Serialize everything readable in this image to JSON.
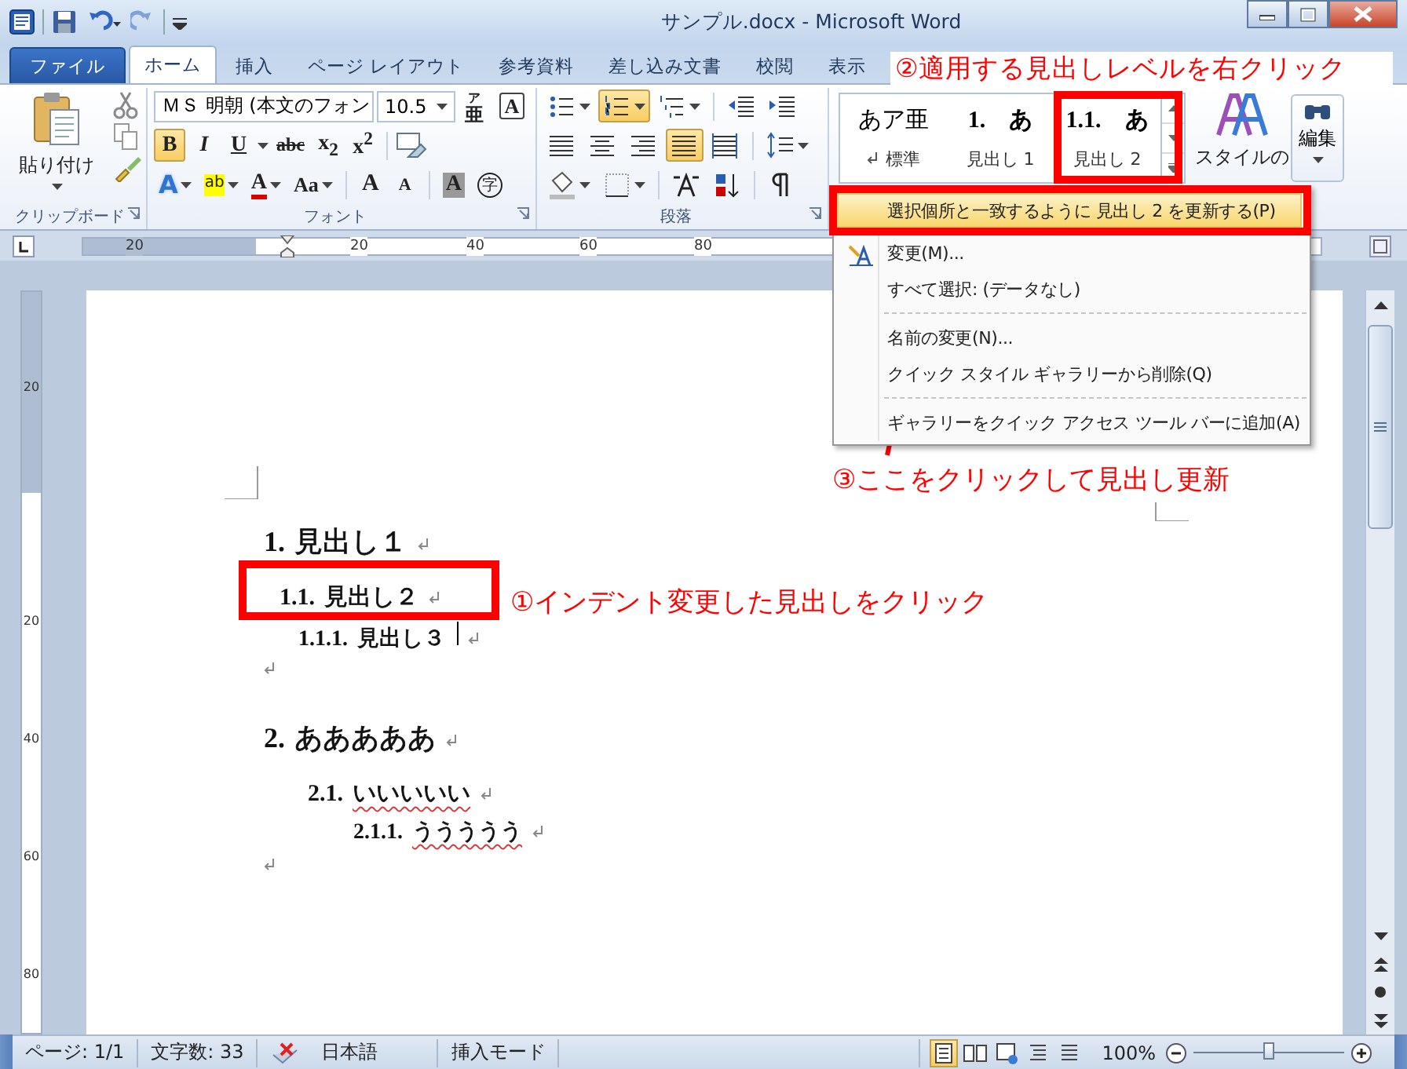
{
  "window": {
    "title": "サンプル.docx - Microsoft Word"
  },
  "tabs": [
    {
      "label": "ファイル",
      "kind": "file",
      "selected": false
    },
    {
      "label": "ホーム",
      "kind": "tab",
      "selected": true
    },
    {
      "label": "挿入",
      "kind": "tab",
      "selected": false
    },
    {
      "label": "ページ レイアウト",
      "kind": "tab",
      "selected": false
    },
    {
      "label": "参考資料",
      "kind": "tab",
      "selected": false
    },
    {
      "label": "差し込み文書",
      "kind": "tab",
      "selected": false
    },
    {
      "label": "校閲",
      "kind": "tab",
      "selected": false
    },
    {
      "label": "表示",
      "kind": "tab",
      "selected": false
    }
  ],
  "ribbon": {
    "clipboard": {
      "paste_label": "貼り付け",
      "group_label": "クリップボード"
    },
    "font": {
      "font_name": "ＭＳ 明朝 (本文のフォン",
      "font_size": "10.5",
      "group_label": "フォント",
      "top_buttons": [
        {
          "kind": "ruby",
          "label": "亜",
          "ruby": "ア"
        },
        {
          "kind": "border",
          "label": "A"
        }
      ],
      "format_buttons": [
        {
          "label": "B",
          "on": true
        },
        {
          "label": "I",
          "on": false
        },
        {
          "label": "U",
          "on": false
        },
        {
          "label": "abc",
          "on": false
        },
        {
          "label": "x$_{2}$",
          "on": false
        },
        {
          "label": "x$^{2}$",
          "on": false
        }
      ],
      "effect_buttons": [
        {
          "kind": "effect",
          "label": "A"
        },
        {
          "kind": "highlight",
          "label": "ab"
        },
        {
          "kind": "color",
          "label": "A"
        },
        {
          "kind": "case",
          "label": "Aa"
        },
        {
          "kind": "grow",
          "label": "A"
        },
        {
          "kind": "shrink",
          "label": "A"
        },
        {
          "kind": "shade",
          "label": "A"
        },
        {
          "kind": "enclose",
          "label": "字"
        }
      ]
    },
    "paragraph": {
      "group_label": "段落",
      "buttons": [
        {
          "kind": "bullets",
          "on": false
        },
        {
          "kind": "numbering",
          "on": true
        },
        {
          "kind": "multilevel",
          "on": false
        },
        {
          "kind": "outdent",
          "on": false
        },
        {
          "kind": "indent",
          "on": false
        },
        {
          "kind": "align-left",
          "on": false
        },
        {
          "kind": "align-center",
          "on": false
        },
        {
          "kind": "align-right",
          "on": false
        },
        {
          "kind": "justify",
          "on": true
        },
        {
          "kind": "distribute",
          "on": false
        },
        {
          "kind": "line-spacing",
          "on": false
        },
        {
          "kind": "shading",
          "on": false
        },
        {
          "kind": "borders",
          "on": false
        },
        {
          "kind": "asian-layout",
          "on": false
        },
        {
          "kind": "sort",
          "on": false
        },
        {
          "kind": "pilcrow",
          "on": false
        }
      ]
    },
    "styles": [
      {
        "preview": "あア亜",
        "label": "標準",
        "kind": "normal",
        "selected": false
      },
      {
        "preview": "1.　あ",
        "label": "見出し 1",
        "kind": "heading",
        "selected": false
      },
      {
        "preview": "1.1.　あ",
        "label": "見出し 2",
        "kind": "heading",
        "selected": false
      }
    ],
    "change_styles": {
      "label": "スタイルの"
    },
    "editing": {
      "label": "編集"
    }
  },
  "ruler": {
    "h_labels": [
      "20",
      "20",
      "40",
      "60",
      "80"
    ],
    "v_labels": [
      "20",
      "20",
      "40",
      "60",
      "80"
    ]
  },
  "document": {
    "paragraphs": [
      {
        "kind": "heading1",
        "number": "1.",
        "text": "見出し１",
        "spell_error": false,
        "cursor": false
      },
      {
        "kind": "heading2",
        "number": "1.1.",
        "text": "見出し２",
        "indent_changed": true,
        "spell_error": false,
        "cursor": false
      },
      {
        "kind": "heading3",
        "number": "1.1.1.",
        "text": "見出し３",
        "indent_changed": true,
        "spell_error": false,
        "cursor": true
      },
      {
        "kind": "empty",
        "cursor": false
      },
      {
        "kind": "heading1",
        "number": "2.",
        "text": "あああああ",
        "spell_error": false,
        "cursor": false
      },
      {
        "kind": "heading2",
        "number": "2.1.",
        "text": "いいいいい",
        "indent_changed": false,
        "spell_error": true,
        "cursor": false
      },
      {
        "kind": "heading3",
        "number": "2.1.1.",
        "text": "ううううう",
        "indent_changed": false,
        "spell_error": true,
        "cursor": false
      },
      {
        "kind": "empty",
        "cursor": false
      }
    ]
  },
  "context_menu": {
    "items": [
      {
        "kind": "item",
        "label": "選択個所と一致するように 見出し 2 を更新する(P)",
        "has_icon": false,
        "selected": true
      },
      {
        "kind": "item",
        "label": "変更(M)...",
        "has_icon": true,
        "selected": false
      },
      {
        "kind": "item",
        "label": "すべて選択: (データなし)",
        "has_icon": false,
        "selected": false
      },
      {
        "kind": "separator"
      },
      {
        "kind": "item",
        "label": "名前の変更(N)...",
        "has_icon": false,
        "selected": false
      },
      {
        "kind": "item",
        "label": "クイック スタイル ギャラリーから削除(Q)",
        "has_icon": false,
        "selected": false
      },
      {
        "kind": "separator"
      },
      {
        "kind": "item",
        "label": "ギャラリーをクイック アクセス ツール バーに追加(A)",
        "has_icon": false,
        "selected": false
      }
    ]
  },
  "annotations": {
    "step1": "①インデント変更した見出しをクリック",
    "step2": "②適用する見出しレベルを右クリック",
    "step3": "③ここをクリックして見出し更新"
  },
  "status_bar": {
    "page": "ページ: 1/1",
    "words": "文字数: 33",
    "language": "日本語",
    "mode": "挿入モード",
    "views": [
      {
        "kind": "print",
        "selected": true
      },
      {
        "kind": "reading",
        "selected": false
      },
      {
        "kind": "web",
        "selected": false
      },
      {
        "kind": "outline",
        "selected": false
      },
      {
        "kind": "draft",
        "selected": false
      }
    ],
    "zoom": "100%",
    "zoom_slider": {
      "level": 0.5
    }
  }
}
